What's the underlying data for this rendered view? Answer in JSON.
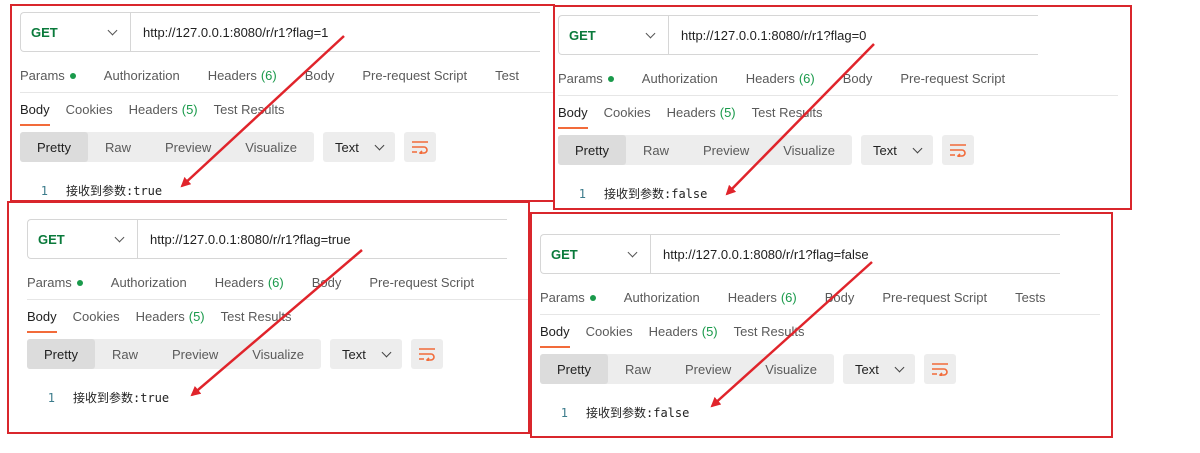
{
  "panels": [
    {
      "method": "GET",
      "url": "http://127.0.0.1:8080/r/r1?flag=1",
      "tabs": {
        "params": "Params",
        "authorization": "Authorization",
        "headers": "Headers",
        "headers_count": "(6)",
        "body": "Body",
        "prerequest": "Pre-request Script",
        "tests": "Test"
      },
      "response_tabs": {
        "body": "Body",
        "cookies": "Cookies",
        "headers": "Headers",
        "headers_count": "(5)",
        "test_results": "Test Results"
      },
      "view_modes": [
        "Pretty",
        "Raw",
        "Preview",
        "Visualize"
      ],
      "format": "Text",
      "line_number": "1",
      "result": "接收到参数:true"
    },
    {
      "method": "GET",
      "url": "http://127.0.0.1:8080/r/r1?flag=0",
      "tabs": {
        "params": "Params",
        "authorization": "Authorization",
        "headers": "Headers",
        "headers_count": "(6)",
        "body": "Body",
        "prerequest": "Pre-request Script",
        "tests": ""
      },
      "response_tabs": {
        "body": "Body",
        "cookies": "Cookies",
        "headers": "Headers",
        "headers_count": "(5)",
        "test_results": "Test Results"
      },
      "view_modes": [
        "Pretty",
        "Raw",
        "Preview",
        "Visualize"
      ],
      "format": "Text",
      "line_number": "1",
      "result": "接收到参数:false"
    },
    {
      "method": "GET",
      "url": "http://127.0.0.1:8080/r/r1?flag=true",
      "tabs": {
        "params": "Params",
        "authorization": "Authorization",
        "headers": "Headers",
        "headers_count": "(6)",
        "body": "Body",
        "prerequest": "Pre-request Script",
        "tests": ""
      },
      "response_tabs": {
        "body": "Body",
        "cookies": "Cookies",
        "headers": "Headers",
        "headers_count": "(5)",
        "test_results": "Test Results"
      },
      "view_modes": [
        "Pretty",
        "Raw",
        "Preview",
        "Visualize"
      ],
      "format": "Text",
      "line_number": "1",
      "result": "接收到参数:true"
    },
    {
      "method": "GET",
      "url": "http://127.0.0.1:8080/r/r1?flag=false",
      "tabs": {
        "params": "Params",
        "authorization": "Authorization",
        "headers": "Headers",
        "headers_count": "(6)",
        "body": "Body",
        "prerequest": "Pre-request Script",
        "tests": "Tests"
      },
      "response_tabs": {
        "body": "Body",
        "cookies": "Cookies",
        "headers": "Headers",
        "headers_count": "(5)",
        "test_results": "Test Results"
      },
      "view_modes": [
        "Pretty",
        "Raw",
        "Preview",
        "Visualize"
      ],
      "format": "Text",
      "line_number": "1",
      "result": "接收到参数:false"
    }
  ],
  "colors": {
    "highlight_border": "#d9262c",
    "arrow": "#e0242b",
    "method_get": "#0a7a3b",
    "active_tab_underline": "#f26b3a",
    "count_green": "#1a9a4b"
  }
}
